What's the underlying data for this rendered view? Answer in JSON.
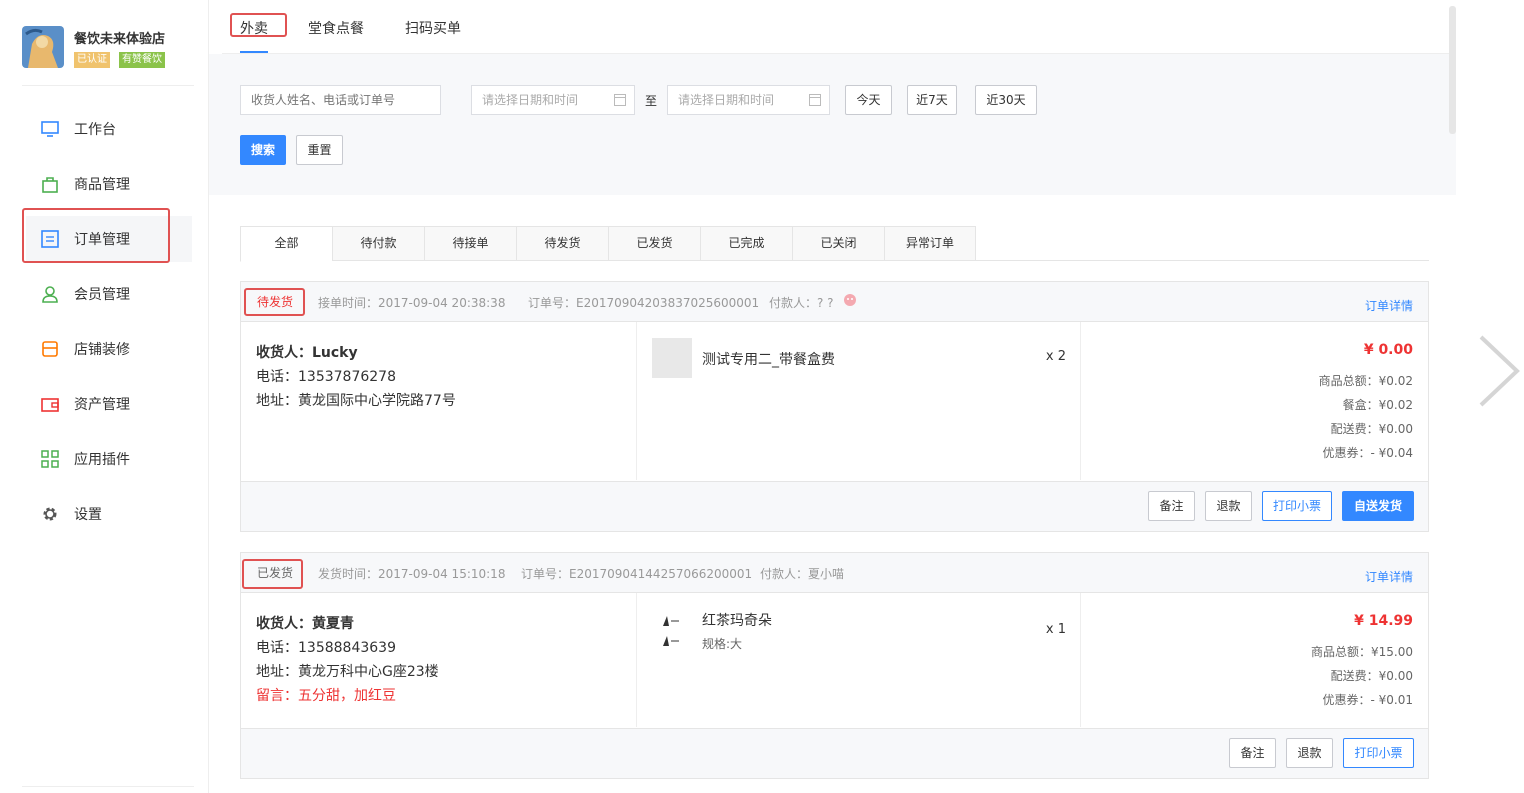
{
  "shop": {
    "name": "餐饮未来体验店",
    "badge_verified": "已认证",
    "badge_catering": "有赞餐饮"
  },
  "nav": {
    "items": [
      {
        "label": "工作台",
        "icon": "monitor-icon"
      },
      {
        "label": "商品管理",
        "icon": "bag-icon"
      },
      {
        "label": "订单管理",
        "icon": "list-icon"
      },
      {
        "label": "会员管理",
        "icon": "user-icon"
      },
      {
        "label": "店铺装修",
        "icon": "shop-icon"
      },
      {
        "label": "资产管理",
        "icon": "wallet-icon"
      },
      {
        "label": "应用插件",
        "icon": "grid-icon"
      },
      {
        "label": "设置",
        "icon": "gear-icon"
      }
    ],
    "active_index": 2
  },
  "top_tabs": [
    "外卖",
    "堂食点餐",
    "扫码买单"
  ],
  "filter": {
    "search_placeholder": "收货人姓名、电话或订单号",
    "date_start_placeholder": "请选择日期和时间",
    "to_label": "至",
    "date_end_placeholder": "请选择日期和时间",
    "today": "今天",
    "last7": "近7天",
    "last30": "近30天",
    "search_btn": "搜索",
    "reset_btn": "重置"
  },
  "status_tabs": [
    "全部",
    "待付款",
    "待接单",
    "待发货",
    "已发货",
    "已完成",
    "已关闭",
    "异常订单"
  ],
  "orders": [
    {
      "status": "待发货",
      "time": "接单时间：2017-09-04 20:38:38",
      "order_no": "订单号：E20170904203837025600001",
      "payer": "付款人：? ?",
      "detail": "订单详情",
      "receiver": "收货人：Lucky",
      "phone": "电话：13537876278",
      "address": "地址：黄龙国际中心学院路77号",
      "goods_name": "测试专用二_带餐盒费",
      "goods_qty": "x 2",
      "total": "¥ 0.00",
      "lines": [
        "商品总额：¥0.02",
        "餐盒：¥0.02",
        "配送费：¥0.00",
        "优惠券：- ¥0.04"
      ],
      "buttons": [
        "备注",
        "退款",
        "打印小票",
        "自送发货"
      ]
    },
    {
      "status": "已发货",
      "time": "发货时间：2017-09-04 15:10:18",
      "order_no": "订单号：E20170904144257066200001",
      "payer": "付款人：夏小喵",
      "detail": "订单详情",
      "receiver": "收货人：黄夏青",
      "phone": "电话：13588843639",
      "address": "地址：黄龙万科中心G座23楼",
      "note": "留言：五分甜，加红豆",
      "goods_name": "红茶玛奇朵",
      "goods_spec": "规格:大",
      "goods_qty": "x 1",
      "total": "¥ 14.99",
      "lines": [
        "商品总额：¥15.00",
        "配送费：¥0.00",
        "优惠券：- ¥0.01"
      ],
      "buttons": [
        "备注",
        "退款",
        "打印小票"
      ]
    }
  ],
  "colors": {
    "primary": "#3388ff",
    "danger": "#e33333",
    "highlight": "#e05252"
  }
}
